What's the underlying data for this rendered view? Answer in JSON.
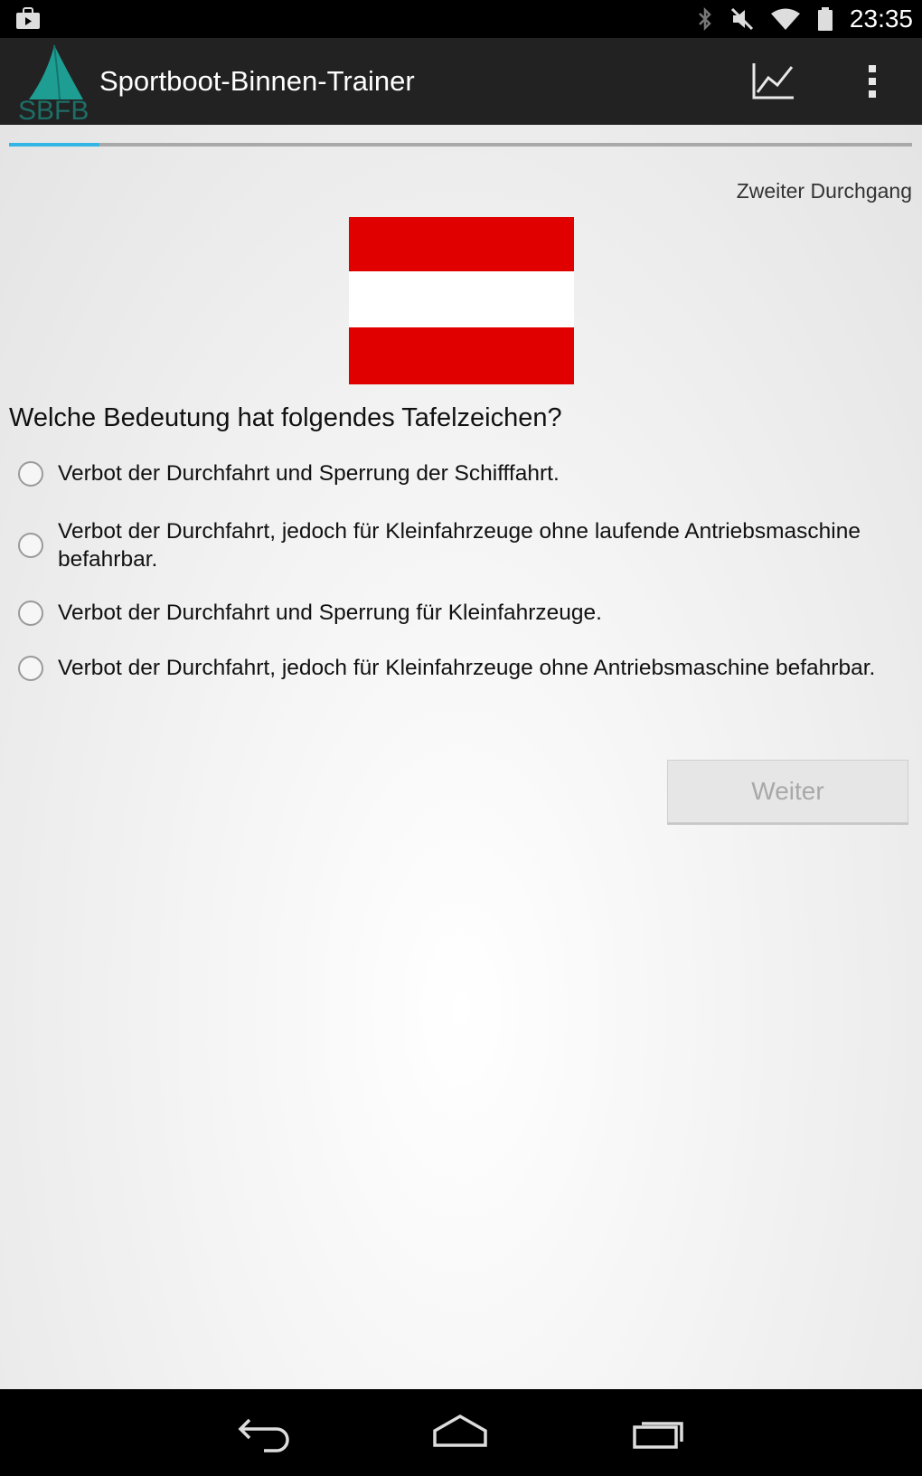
{
  "status_bar": {
    "time": "23:35",
    "icons": [
      "shop-bag-icon",
      "bluetooth-icon",
      "mute-icon",
      "wifi-icon",
      "battery-icon"
    ]
  },
  "action_bar": {
    "title": "Sportboot-Binnen-Trainer",
    "logo_text": "SBFB",
    "icons": [
      "stats-chart-icon",
      "overflow-menu-icon"
    ]
  },
  "progress": {
    "fraction": 0.1,
    "color": "#33b5e5"
  },
  "round_label": "Zweiter Durchgang",
  "sign": {
    "colors": [
      "#e00000",
      "#ffffff",
      "#e00000"
    ]
  },
  "question": "Welche Bedeutung hat folgendes Tafelzeichen?",
  "options": [
    {
      "label": "Verbot der Durchfahrt und Sperrung der Schifffahrt.",
      "selected": false
    },
    {
      "label": "Verbot der Durchfahrt, jedoch für Kleinfahrzeuge ohne laufende Antriebsmaschine befahrbar.",
      "selected": false
    },
    {
      "label": "Verbot der Durchfahrt und Sperrung für Kleinfahrzeuge.",
      "selected": false
    },
    {
      "label": "Verbot der Durchfahrt, jedoch für Kleinfahrzeuge ohne Antriebsmaschine befahrbar.",
      "selected": false
    }
  ],
  "next_button": {
    "label": "Weiter",
    "enabled": false
  },
  "nav_bar": {
    "icons": [
      "back-icon",
      "home-icon",
      "recent-apps-icon"
    ]
  }
}
